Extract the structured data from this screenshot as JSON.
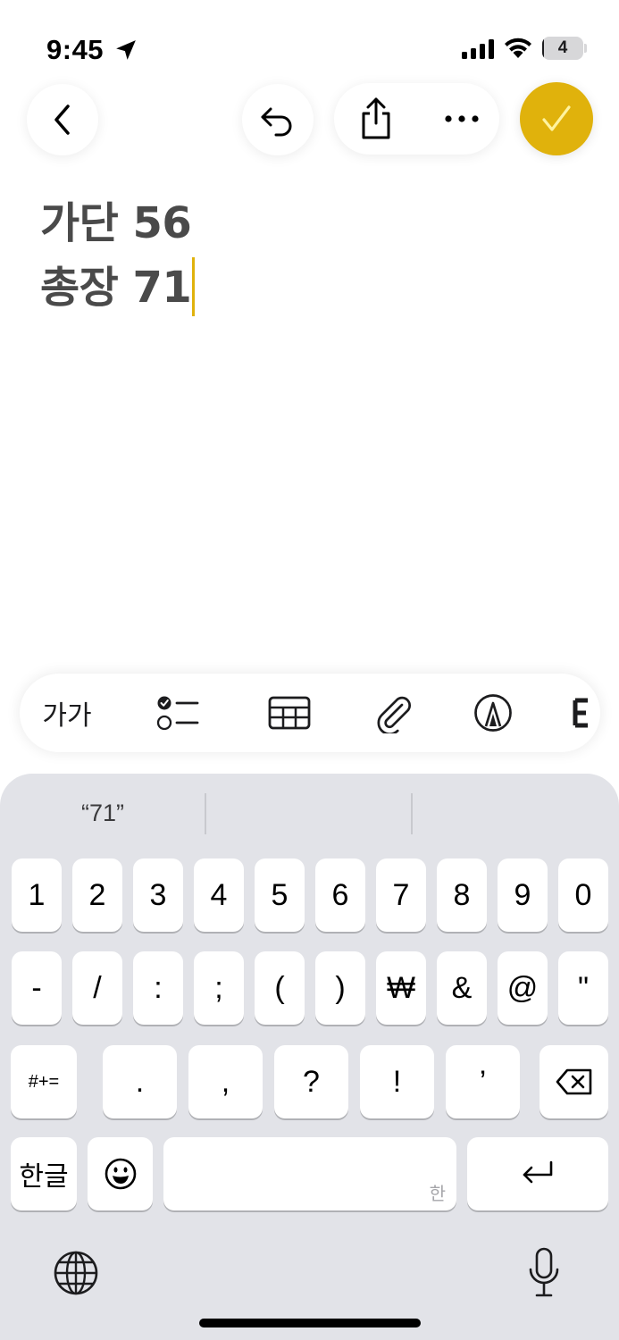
{
  "status_bar": {
    "time": "9:45",
    "battery_level": "4",
    "battery_fraction": 0.04,
    "icons": [
      "location-arrow-icon",
      "cellular-signal-icon",
      "wifi-icon",
      "battery-icon"
    ]
  },
  "toolbar": {
    "icons": [
      "chevron-left-icon",
      "undo-icon",
      "share-icon",
      "ellipsis-icon",
      "checkmark-icon"
    ],
    "accent_color": "#e0b20c"
  },
  "note": {
    "lines": [
      "가단 56",
      "총장 71"
    ]
  },
  "format_bar": {
    "text_style_label": "가가",
    "icons": [
      "checklist-icon",
      "table-icon",
      "paperclip-icon",
      "markup-pen-icon",
      "more-tools-icon"
    ]
  },
  "keyboard": {
    "suggestions": [
      "“71”",
      "",
      ""
    ],
    "row1": [
      "1",
      "2",
      "3",
      "4",
      "5",
      "6",
      "7",
      "8",
      "9",
      "0"
    ],
    "row2": [
      "-",
      "/",
      ":",
      ";",
      "(",
      ")",
      "₩",
      "&",
      "@",
      "\""
    ],
    "row3_shift": "#+=",
    "row3": [
      ".",
      ",",
      "?",
      "!",
      "’"
    ],
    "lang_key": "한글",
    "space_hint": "한",
    "icons": [
      "delete-backspace-icon",
      "emoji-icon",
      "return-icon",
      "globe-icon",
      "microphone-icon"
    ]
  }
}
